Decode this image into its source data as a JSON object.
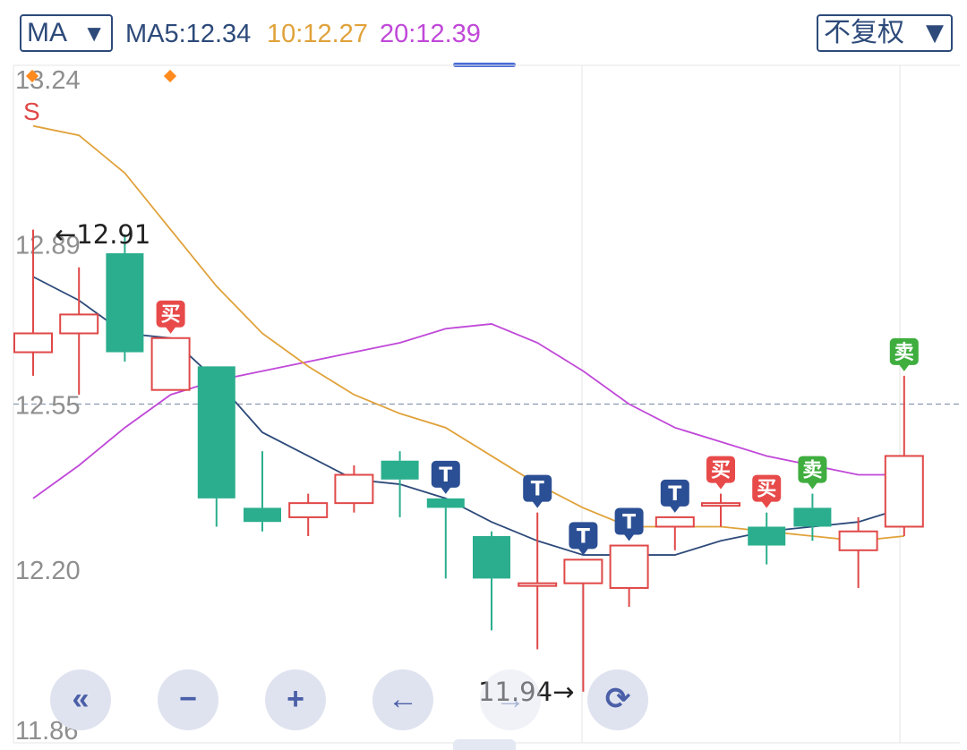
{
  "header": {
    "indicator_select": "MA",
    "ma5": "MA5:12.34",
    "ma10": "10:12.27",
    "ma20": "20:12.39",
    "adjust_select": "不复权",
    "colors": {
      "ma5": "#2d4a7a",
      "ma10": "#e0a23a",
      "ma20": "#c048d8",
      "up": "#e04848",
      "down": "#2bae8e"
    }
  },
  "chart_data": {
    "type": "candlestick",
    "y_axis_labels": [
      "13.24",
      "12.89",
      "12.55",
      "12.20",
      "11.86"
    ],
    "ylim": [
      11.86,
      13.24
    ],
    "reference_price": 12.55,
    "high_marker": "←12.91",
    "low_marker": "11.94→",
    "s_marker": "S",
    "candles": [
      {
        "open": 12.66,
        "close": 12.7,
        "high": 12.92,
        "low": 12.61
      },
      {
        "open": 12.7,
        "close": 12.74,
        "high": 12.84,
        "low": 12.57
      },
      {
        "open": 12.87,
        "close": 12.66,
        "high": 12.91,
        "low": 12.64
      },
      {
        "open": 12.58,
        "close": 12.69,
        "high": 12.69,
        "low": 12.58
      },
      {
        "open": 12.63,
        "close": 12.35,
        "high": 12.63,
        "low": 12.29
      },
      {
        "open": 12.33,
        "close": 12.3,
        "high": 12.45,
        "low": 12.28
      },
      {
        "open": 12.31,
        "close": 12.34,
        "high": 12.36,
        "low": 12.27
      },
      {
        "open": 12.34,
        "close": 12.4,
        "high": 12.42,
        "low": 12.32
      },
      {
        "open": 12.43,
        "close": 12.39,
        "high": 12.45,
        "low": 12.31
      },
      {
        "open": 12.35,
        "close": 12.33,
        "high": 12.35,
        "low": 12.18
      },
      {
        "open": 12.27,
        "close": 12.18,
        "high": 12.28,
        "low": 12.07
      },
      {
        "open": 12.17,
        "close": 12.17,
        "high": 12.32,
        "low": 12.03
      },
      {
        "open": 12.17,
        "close": 12.22,
        "high": 12.22,
        "low": 11.94
      },
      {
        "open": 12.16,
        "close": 12.25,
        "high": 12.25,
        "low": 12.12
      },
      {
        "open": 12.29,
        "close": 12.31,
        "high": 12.31,
        "low": 12.24
      },
      {
        "open": 12.34,
        "close": 12.34,
        "high": 12.36,
        "low": 12.29
      },
      {
        "open": 12.29,
        "close": 12.25,
        "high": 12.32,
        "low": 12.21
      },
      {
        "open": 12.33,
        "close": 12.29,
        "high": 12.36,
        "low": 12.26
      },
      {
        "open": 12.24,
        "close": 12.28,
        "high": 12.31,
        "low": 12.16
      },
      {
        "open": 12.29,
        "close": 12.44,
        "high": 12.61,
        "low": 12.27
      }
    ],
    "ma5": [
      12.82,
      12.77,
      12.7,
      12.69,
      12.6,
      12.49,
      12.44,
      12.39,
      12.38,
      12.35,
      12.3,
      12.26,
      12.23,
      12.23,
      12.23,
      12.26,
      12.28,
      12.29,
      12.3,
      12.33
    ],
    "ma10": [
      13.14,
      13.12,
      13.04,
      12.92,
      12.8,
      12.7,
      12.63,
      12.57,
      12.53,
      12.5,
      12.44,
      12.38,
      12.33,
      12.29,
      12.29,
      12.29,
      12.28,
      12.27,
      12.26,
      12.27
    ],
    "ma20": [
      12.35,
      12.42,
      12.5,
      12.57,
      12.6,
      12.62,
      12.64,
      12.66,
      12.68,
      12.71,
      12.72,
      12.68,
      12.62,
      12.55,
      12.5,
      12.47,
      12.44,
      12.42,
      12.4,
      12.4
    ],
    "signals": [
      {
        "index": 3,
        "label": "买",
        "color": "#e84a4a",
        "position": "above"
      },
      {
        "index": 9,
        "label": "T",
        "color": "#2b4f94",
        "position": "above"
      },
      {
        "index": 11,
        "label": "T",
        "color": "#2b4f94",
        "position": "above"
      },
      {
        "index": 12,
        "label": "T",
        "color": "#2b4f94",
        "position": "above"
      },
      {
        "index": 13,
        "label": "T",
        "color": "#2b4f94",
        "position": "above"
      },
      {
        "index": 14,
        "label": "T",
        "color": "#2b4f94",
        "position": "above"
      },
      {
        "index": 15,
        "label": "买",
        "color": "#e84a4a",
        "position": "above"
      },
      {
        "index": 16,
        "label": "买",
        "color": "#e84a4a",
        "position": "above"
      },
      {
        "index": 17,
        "label": "卖",
        "color": "#3fae3f",
        "position": "above"
      },
      {
        "index": 19,
        "label": "卖",
        "color": "#3fae3f",
        "position": "above"
      }
    ]
  },
  "controls": [
    "«",
    "−",
    "+",
    "←",
    "→",
    "⟳"
  ]
}
